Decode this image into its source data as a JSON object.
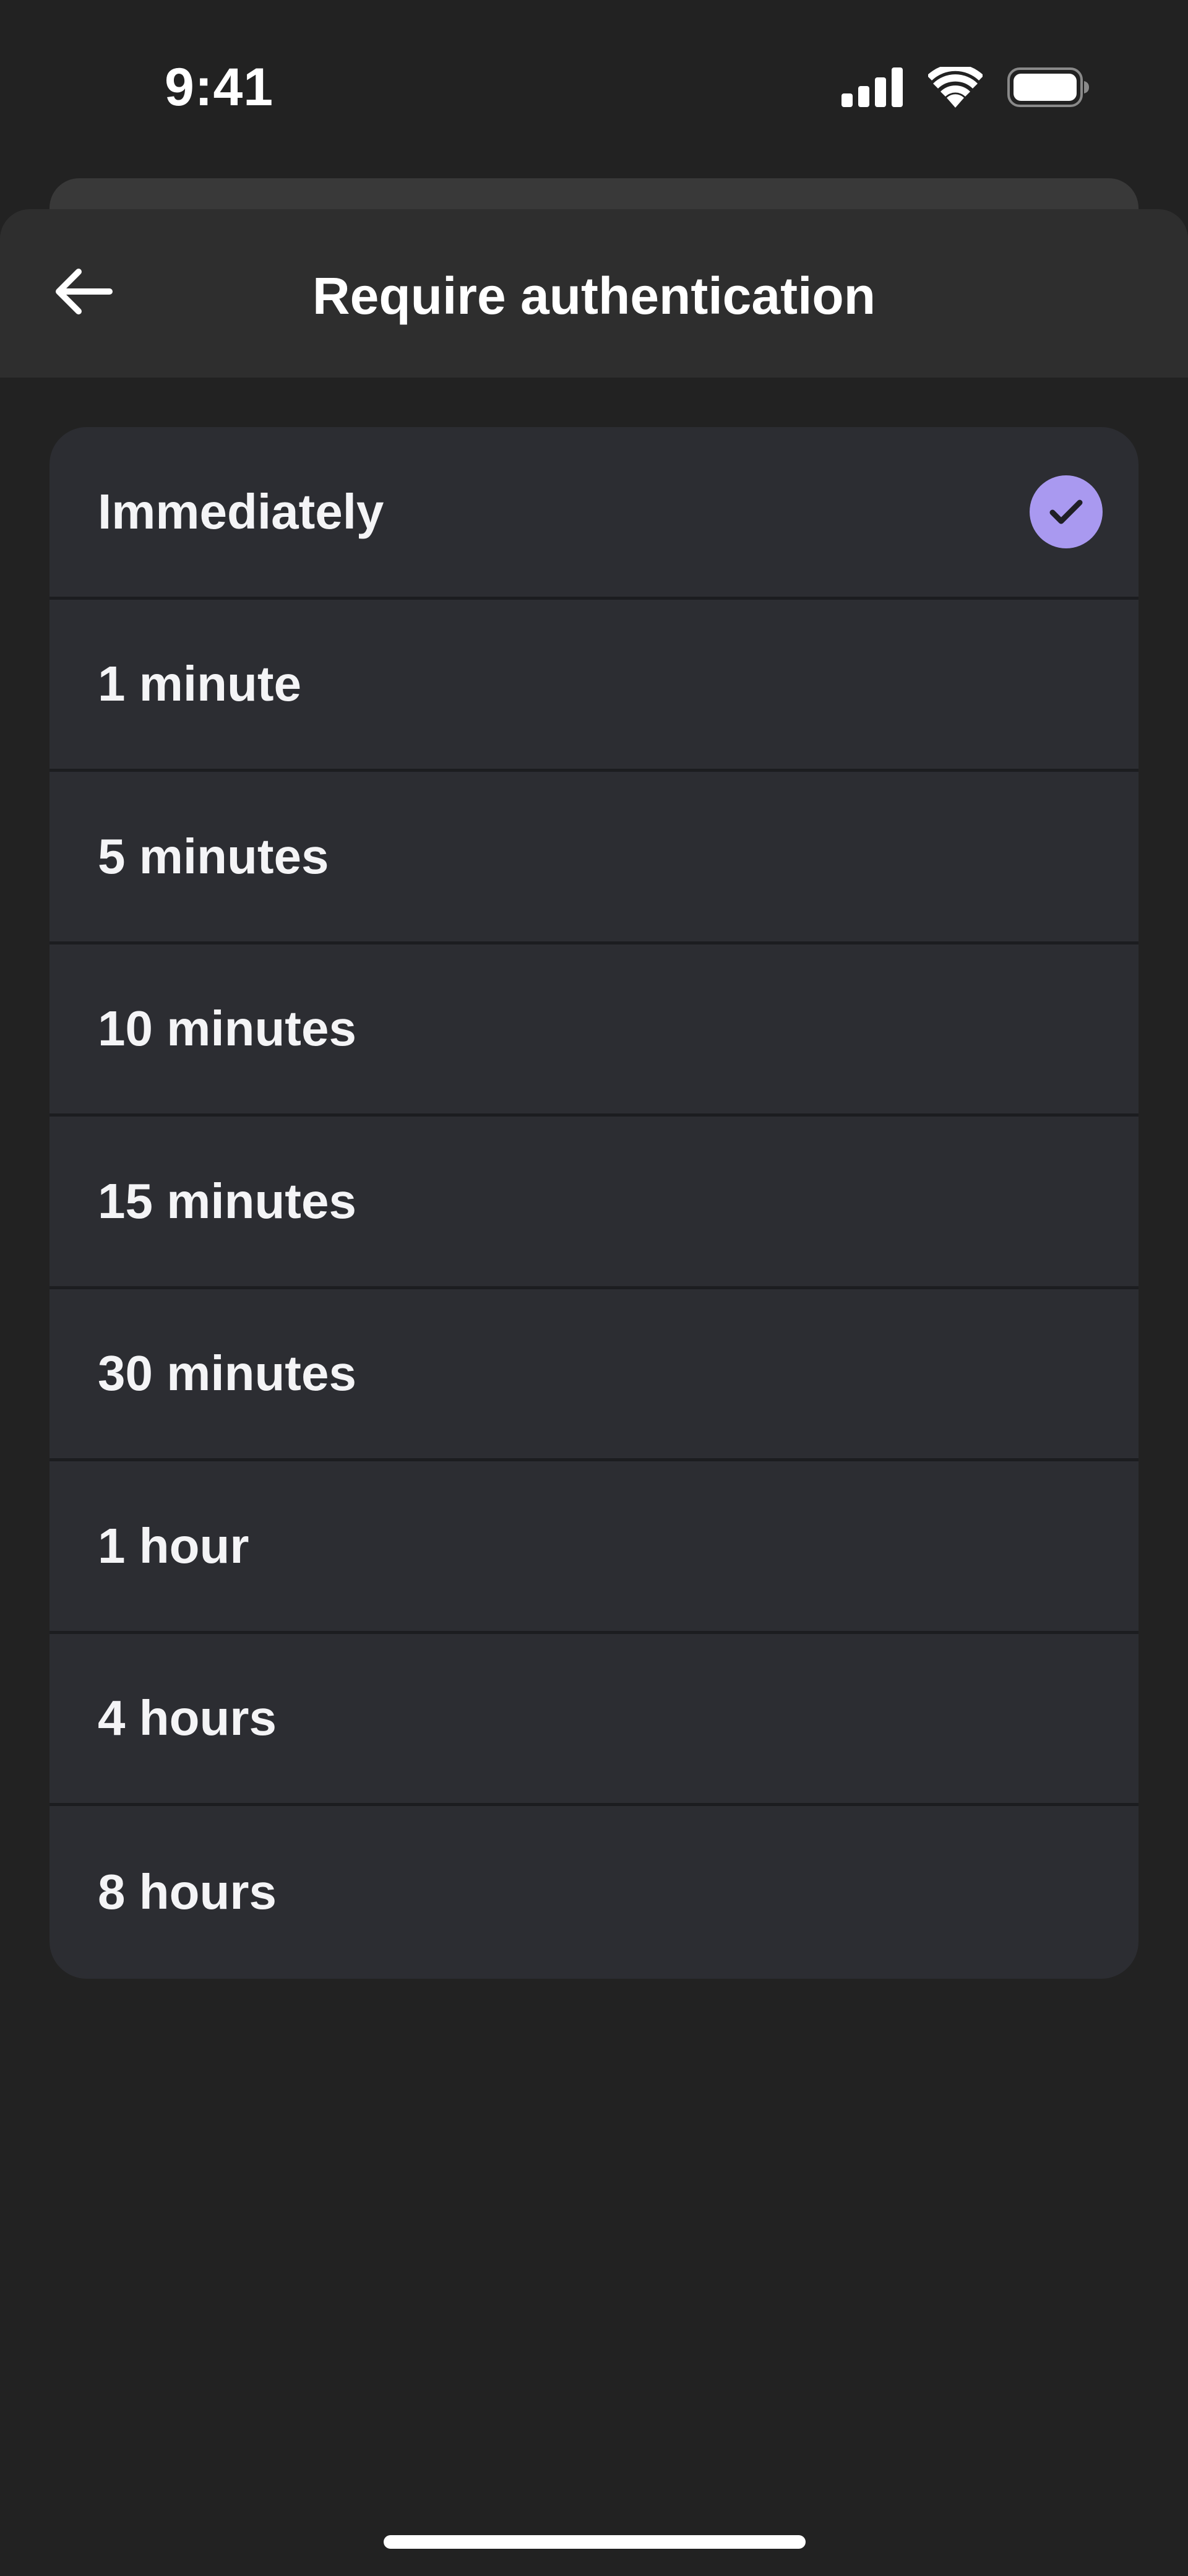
{
  "status_bar": {
    "time": "9:41",
    "icons": [
      "cellular-signal-icon",
      "wifi-icon",
      "battery-icon"
    ]
  },
  "header": {
    "title": "Require authentication",
    "back_icon": "arrow-left-icon"
  },
  "options": [
    {
      "label": "Immediately",
      "selected": true
    },
    {
      "label": "1 minute",
      "selected": false
    },
    {
      "label": "5 minutes",
      "selected": false
    },
    {
      "label": "10 minutes",
      "selected": false
    },
    {
      "label": "15 minutes",
      "selected": false
    },
    {
      "label": "30 minutes",
      "selected": false
    },
    {
      "label": "1 hour",
      "selected": false
    },
    {
      "label": "4 hours",
      "selected": false
    },
    {
      "label": "8 hours",
      "selected": false
    }
  ],
  "colors": {
    "background": "#222222",
    "header_background": "#2e2e2e",
    "list_background": "#2c2d32",
    "divider": "#1c1d20",
    "accent": "#a999f0",
    "check_mark": "#1f1f25",
    "text": "#f4f4f6"
  }
}
